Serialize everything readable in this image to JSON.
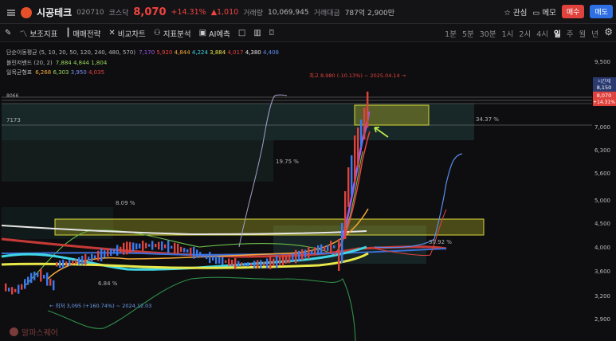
{
  "header": {
    "name": "시공테크",
    "code": "020710",
    "market": "코스닥",
    "price": "8,070",
    "change_pct": "+14.31%",
    "change_abs": "▲1,010",
    "volume_label": "거래량",
    "volume": "10,069,945",
    "amount_label": "거래대금",
    "amount": "787억 2,900만",
    "watch_label": "관심",
    "memo_label": "메모",
    "buy_label": "매수",
    "sell_label": "매도"
  },
  "toolbar": {
    "tools": [
      "보조지표",
      "매매전략",
      "비교차트",
      "지표분석",
      "AI예측"
    ],
    "periods": [
      "1분",
      "5분",
      "30분",
      "1시",
      "2시",
      "4시",
      "일",
      "주",
      "월",
      "년"
    ],
    "active_period": "일"
  },
  "indicators": {
    "ma": {
      "label": "단순이동평균 (5, 10, 20, 50, 120, 240, 480, 570)",
      "values": [
        "7,170",
        "5,920",
        "4,844",
        "4,224",
        "3,884",
        "4,017",
        "4,380",
        "4,408"
      ],
      "colors": [
        "#9c5cf0",
        "#f0433f",
        "#f3a73a",
        "#3fd6e6",
        "#e8e84a",
        "#e0433e",
        "#e6e6e6",
        "#5a8ef0"
      ]
    },
    "bollinger": {
      "label": "볼린저밴드 (20, 2)",
      "values": [
        "7,884",
        "4,844",
        "1,804"
      ],
      "colors": [
        "#9ad65a",
        "#9ad65a",
        "#9ad65a"
      ]
    },
    "ichimoku": {
      "label": "일목균형표",
      "values": [
        "6,268",
        "6,303",
        "3,950",
        "4,035"
      ],
      "colors": [
        "#f3a73a",
        "#9ad65a",
        "#7a8cf0",
        "#e0433e"
      ]
    }
  },
  "annotations": {
    "high": "최고 8,980 (-10.13%) ~ 2025.04.14 →",
    "low": "← 최저 3,095 (+160.74%) ~ 2024.12.03",
    "pct_1": "34.37 %",
    "pct_2": "19.75 %",
    "pct_3": "8.09 %",
    "pct_4": "30.92 %",
    "pct_5": "6.84 %",
    "level_1": "7173",
    "level_2": "8066",
    "current_label": "시간제",
    "current_price": "8,150",
    "current_price2": "8,070",
    "current_pct": "+14.31%"
  },
  "axis": {
    "ticks": [
      "9,500",
      "8,500",
      "7,000",
      "6,300",
      "5,600",
      "5,000",
      "4,500",
      "4,000",
      "3,600",
      "3,200",
      "2,900"
    ]
  },
  "watermark": "알파스퀘어"
}
